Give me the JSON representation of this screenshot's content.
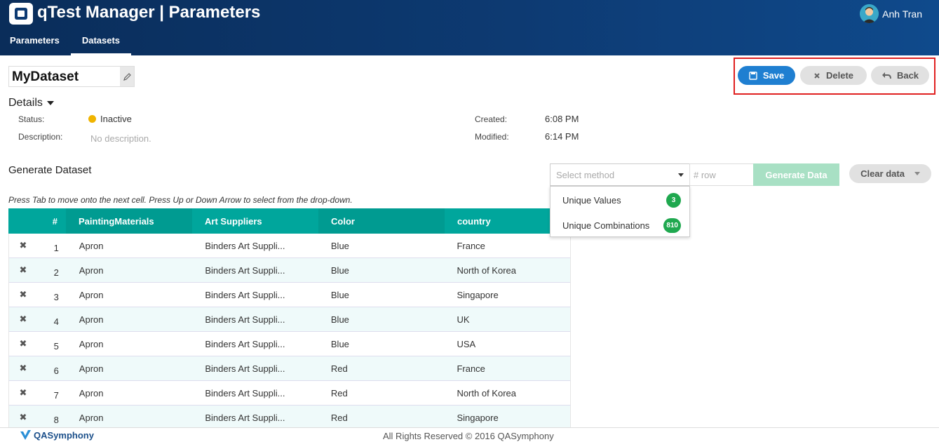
{
  "header": {
    "app_title": "qTest Manager | Parameters",
    "user_name": "Anh Tran",
    "tabs": [
      {
        "label": "Parameters",
        "active": false
      },
      {
        "label": "Datasets",
        "active": true
      }
    ]
  },
  "dataset": {
    "name": "MyDataset"
  },
  "actions": {
    "save_label": "Save",
    "delete_label": "Delete",
    "back_label": "Back"
  },
  "details": {
    "title": "Details",
    "status_label": "Status:",
    "status_value": "Inactive",
    "description_label": "Description:",
    "description_value": "No description.",
    "created_label": "Created:",
    "created_value": "6:08 PM",
    "modified_label": "Modified:",
    "modified_value": "6:14 PM"
  },
  "generate": {
    "title": "Generate Dataset",
    "hint": "Press Tab to move onto the next cell. Press Up or Down Arrow to select from the drop-down.",
    "method_placeholder": "Select method",
    "row_placeholder": "# row",
    "generate_label": "Generate Data",
    "clear_label": "Clear data",
    "methods": [
      {
        "label": "Unique Values",
        "count": "3"
      },
      {
        "label": "Unique Combinations",
        "count": "810"
      }
    ]
  },
  "table": {
    "columns": [
      "#",
      "PaintingMaterials",
      "Art Suppliers",
      "Color",
      "country"
    ],
    "rows": [
      {
        "num": "1",
        "c1": "Apron",
        "c2": "Binders Art Suppli...",
        "c3": "Blue",
        "c4": "France"
      },
      {
        "num": "2",
        "c1": "Apron",
        "c2": "Binders Art Suppli...",
        "c3": "Blue",
        "c4": "North of Korea"
      },
      {
        "num": "3",
        "c1": "Apron",
        "c2": "Binders Art Suppli...",
        "c3": "Blue",
        "c4": "Singapore"
      },
      {
        "num": "4",
        "c1": "Apron",
        "c2": "Binders Art Suppli...",
        "c3": "Blue",
        "c4": "UK"
      },
      {
        "num": "5",
        "c1": "Apron",
        "c2": "Binders Art Suppli...",
        "c3": "Blue",
        "c4": "USA"
      },
      {
        "num": "6",
        "c1": "Apron",
        "c2": "Binders Art Suppli...",
        "c3": "Red",
        "c4": "France"
      },
      {
        "num": "7",
        "c1": "Apron",
        "c2": "Binders Art Suppli...",
        "c3": "Red",
        "c4": "North of Korea"
      },
      {
        "num": "8",
        "c1": "Apron",
        "c2": "Binders Art Suppli...",
        "c3": "Red",
        "c4": "Singapore"
      }
    ]
  },
  "footer": {
    "brand": "QASymphony",
    "copyright": "All Rights Reserved © 2016 QASymphony"
  },
  "colors": {
    "header_bg": "#0d3a72",
    "save": "#1f7fd1",
    "table_header": "#00a69c",
    "badge": "#1fa84f",
    "status_dot": "#f0b400",
    "highlight_frame": "#e02020"
  },
  "icons": {
    "logo": "qtest-logo-icon",
    "edit": "pencil-icon",
    "save": "floppy-disk-icon",
    "delete": "close-icon",
    "back": "undo-arrow-icon",
    "row_delete": "close-icon"
  }
}
